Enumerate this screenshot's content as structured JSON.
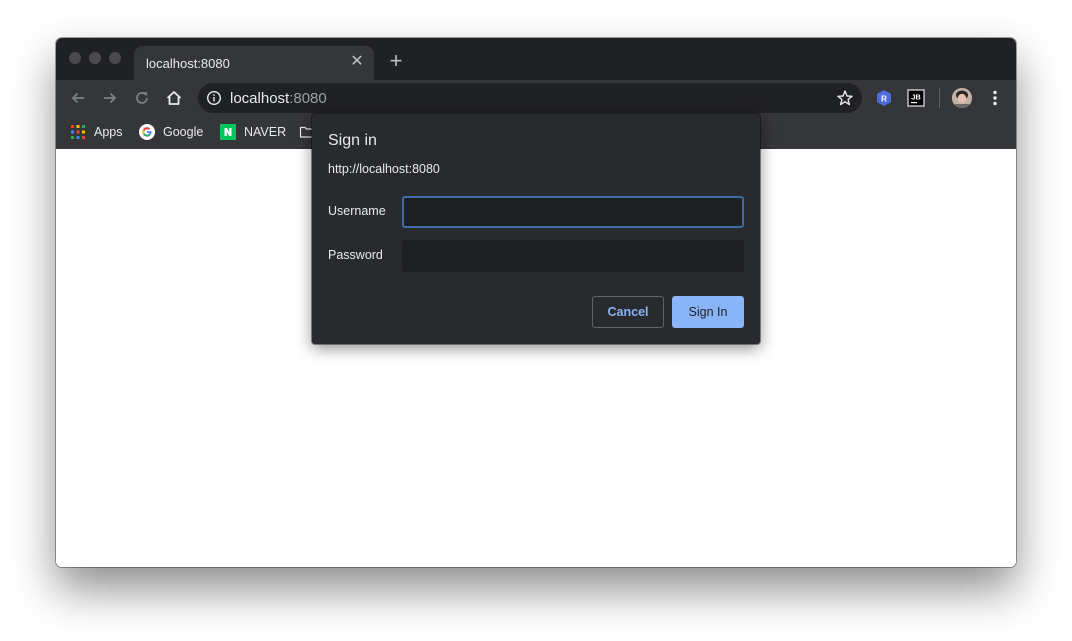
{
  "tab": {
    "title": "localhost:8080"
  },
  "omnibox": {
    "host": "localhost",
    "port": ":8080"
  },
  "bookmarks": [
    {
      "label": "Apps",
      "icon": "apps-grid-icon"
    },
    {
      "label": "Google",
      "icon": "google-icon"
    },
    {
      "label": "NAVER",
      "icon": "naver-icon"
    }
  ],
  "extensions": [
    {
      "label": "R",
      "icon": "r-extension-icon"
    },
    {
      "label": "JB",
      "icon": "jetbrains-extension-icon"
    }
  ],
  "dialog": {
    "title": "Sign in",
    "origin": "http://localhost:8080",
    "username_label": "Username",
    "username_value": "",
    "password_label": "Password",
    "password_value": "",
    "cancel_label": "Cancel",
    "signin_label": "Sign In"
  },
  "colors": {
    "accent": "#8ab4f8",
    "frame": "#202124",
    "toolbar": "#35363a",
    "naver_green": "#03c75a",
    "extension_blue": "#4f6bdc"
  }
}
